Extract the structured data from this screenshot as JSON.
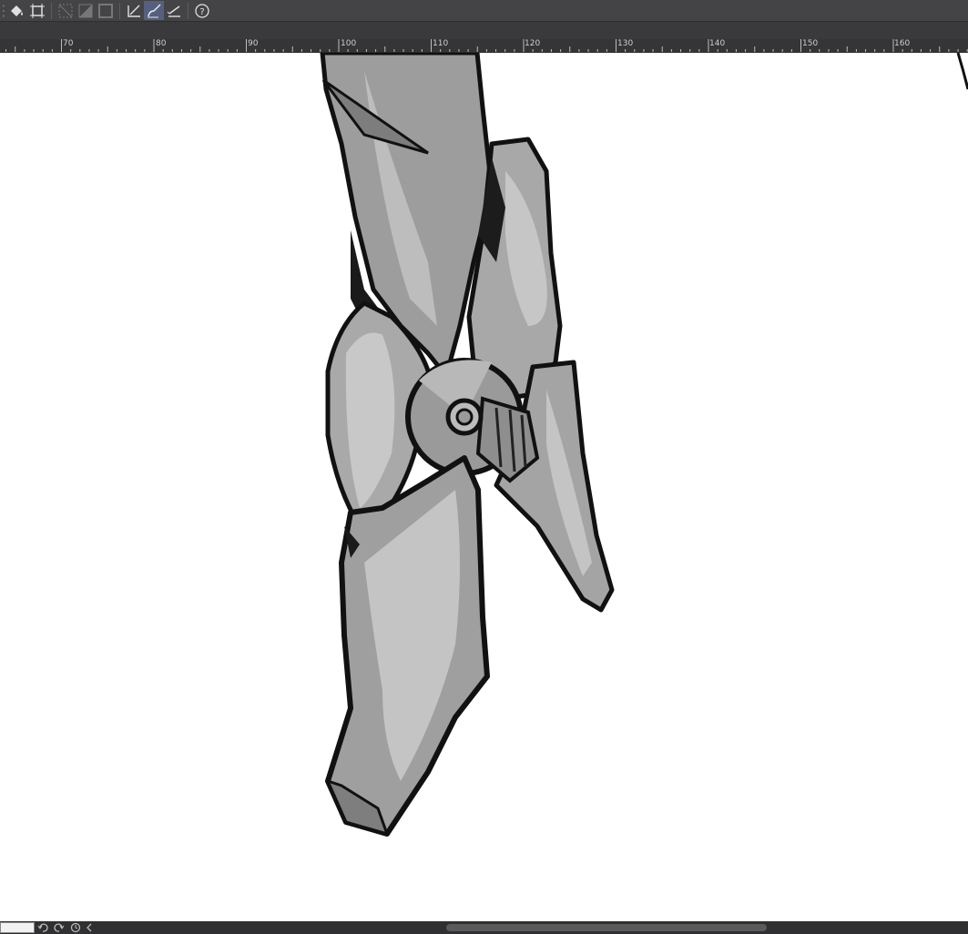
{
  "toolbar": {
    "buttons": [
      {
        "name": "fill-tool-icon",
        "state": "normal"
      },
      {
        "name": "transform-tool-icon",
        "state": "normal"
      },
      {
        "name": "select-none-icon",
        "state": "disabled"
      },
      {
        "name": "invert-selection-icon",
        "state": "disabled"
      },
      {
        "name": "selection-border-icon",
        "state": "disabled"
      },
      {
        "name": "ruler-snap-icon",
        "state": "normal"
      },
      {
        "name": "brush-snap-icon",
        "state": "active"
      },
      {
        "name": "line-snap-icon",
        "state": "normal"
      },
      {
        "name": "help-icon",
        "state": "normal"
      }
    ]
  },
  "ruler": {
    "labels": [
      "70",
      "80",
      "90",
      "100",
      "110",
      "120",
      "130",
      "140",
      "150",
      "160"
    ]
  },
  "canvas": {
    "subject": "grayscale robot leg sketch"
  },
  "statusbar": {
    "buttons": [
      "undo-icon",
      "redo-icon",
      "history-icon",
      "collapse-icon"
    ]
  }
}
